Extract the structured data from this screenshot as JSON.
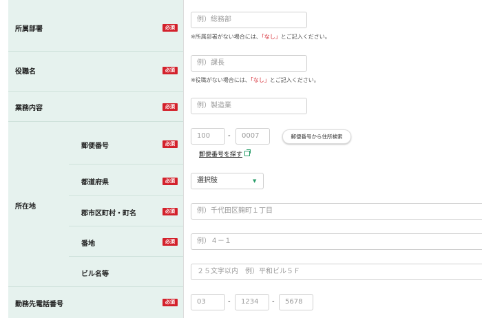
{
  "required_badge": "必須",
  "department": {
    "label": "所属部署",
    "placeholder": "例）総務部",
    "note_prefix": "※所属部署がない場合には、",
    "note_highlight": "「なし」",
    "note_suffix": "とご記入ください。"
  },
  "position": {
    "label": "役職名",
    "placeholder": "例）課長",
    "note_prefix": "※役職がない場合には、",
    "note_highlight": "「なし」",
    "note_suffix": "とご記入ください。"
  },
  "business": {
    "label": "業務内容",
    "placeholder": "例）製造業"
  },
  "address": {
    "label": "所在地",
    "postal": {
      "label": "郵便番号",
      "part1_placeholder": "100",
      "separator": "-",
      "part2_placeholder": "0007",
      "search_button": "郵便番号から住所検索",
      "find_link": "郵便番号を探す"
    },
    "prefecture": {
      "label": "都道府県",
      "selected": "選択肢"
    },
    "city": {
      "label": "郡市区町村・町名",
      "placeholder": "例）千代田区麹町１丁目"
    },
    "block": {
      "label": "番地",
      "placeholder": "例）４－１"
    },
    "building": {
      "label": "ビル名等",
      "placeholder": "２５文字以内　例）平和ビル５Ｆ"
    }
  },
  "phone": {
    "label": "勤務先電話番号",
    "part1_placeholder": "03",
    "separator": "-",
    "part2_placeholder": "1234",
    "part3_placeholder": "5678"
  },
  "colors": {
    "label_bg": "#e6f2ee",
    "required_red": "#d3212b",
    "accent_green": "#2a9d6a"
  }
}
